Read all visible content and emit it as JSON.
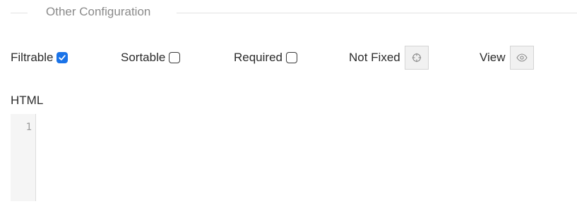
{
  "section": {
    "title": "Other Configuration"
  },
  "options": {
    "filtrable": {
      "label": "Filtrable",
      "checked": true
    },
    "sortable": {
      "label": "Sortable",
      "checked": false
    },
    "required": {
      "label": "Required",
      "checked": false
    },
    "fixed": {
      "label": "Not Fixed",
      "icon": "crosshair-icon"
    },
    "view": {
      "label": "View",
      "icon": "eye-icon"
    }
  },
  "editor": {
    "label": "HTML",
    "line_numbers": [
      "1"
    ],
    "content": ""
  },
  "colors": {
    "accent": "#1a73e8",
    "section_title": "#8a8a8a",
    "divider": "#e1e1e1",
    "gutter_bg": "#f5f5f5",
    "icon_button_bg": "#f1f1f1"
  }
}
